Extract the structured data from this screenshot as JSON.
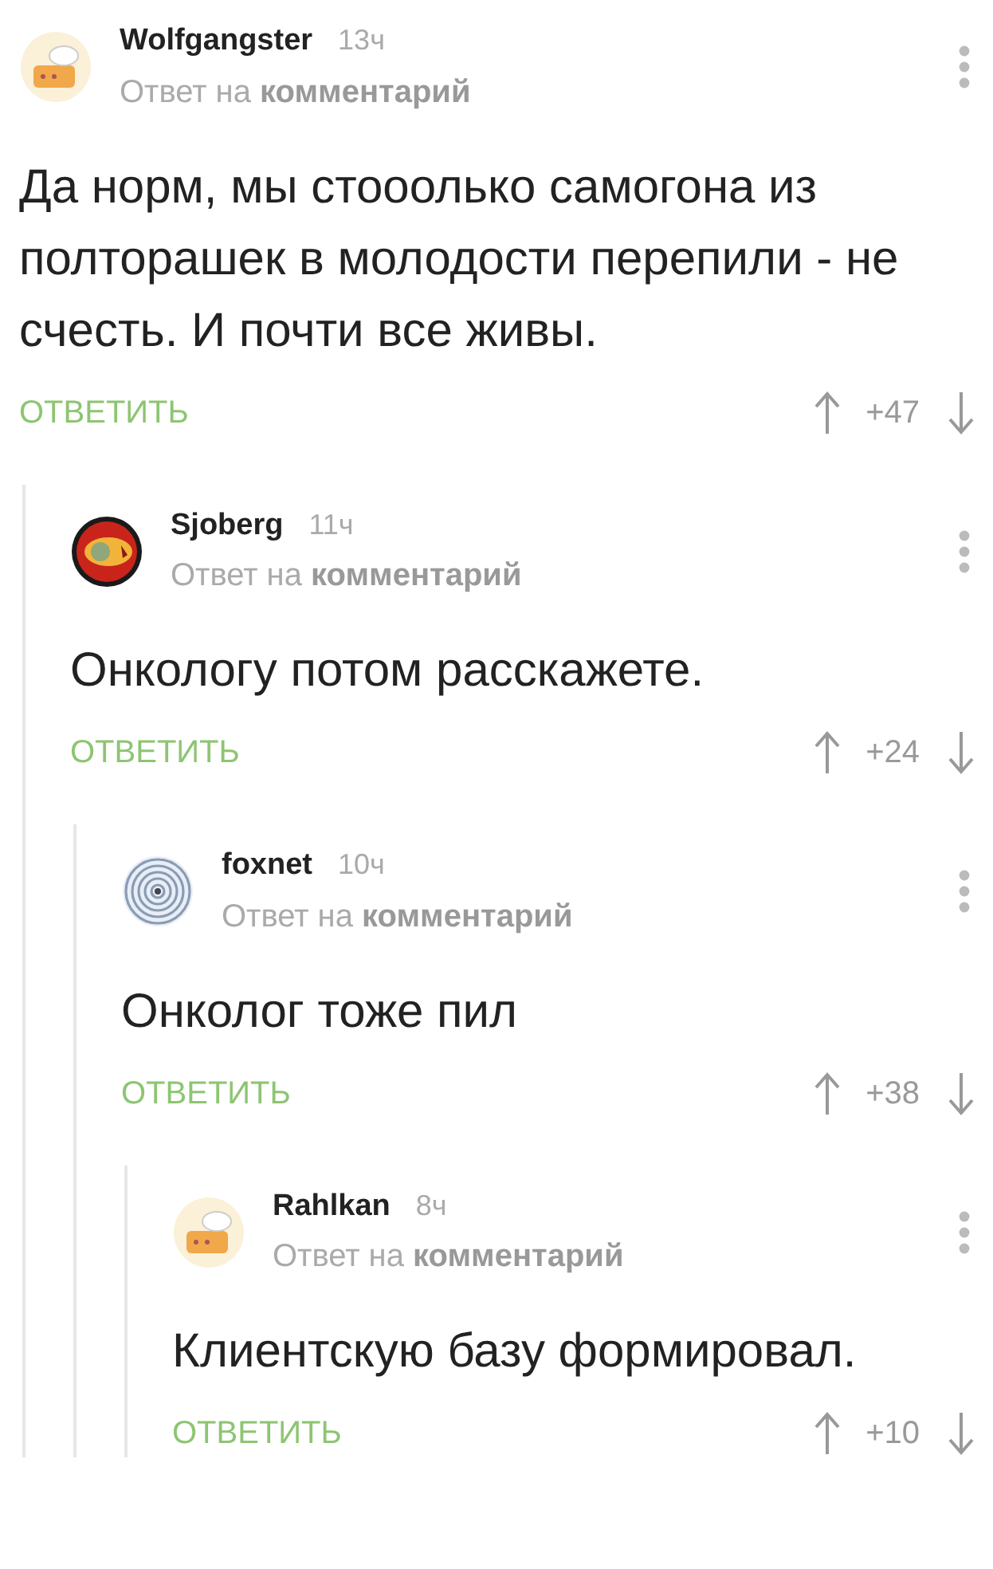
{
  "comments": [
    {
      "author": "Wolfgangster",
      "time": "13ч",
      "reply_to": "Ответ на **комментарий**",
      "text": "Да норм, мы стооолько самогона из полторашек в молодости перепили - не счесть. И почти все живы.",
      "reply": "ОТВЕТИТЬ",
      "score": "+47",
      "children": [
        {
          "author": "Sjoberg",
          "time": "11ч",
          "reply_to": "Ответ на **комментарий**",
          "text": "Онкологу потом расскажете.",
          "reply": "ОТВЕТИТЬ",
          "score": "+24",
          "children": [
            {
              "author": "foxnet",
              "time": "10ч",
              "reply_to": "Ответ на **комментарий**",
              "text": "Онколог тоже пил",
              "reply": "ОТВЕТИТЬ",
              "score": "+38",
              "children": [
                {
                  "author": "Rahlkan",
                  "time": "8ч",
                  "reply_to": "Ответ на **комментарий**",
                  "text": "Клиентскую базу формировал.",
                  "reply": "ОТВЕТИТЬ",
                  "score": "+10"
                }
              ]
            }
          ]
        }
      ]
    }
  ]
}
